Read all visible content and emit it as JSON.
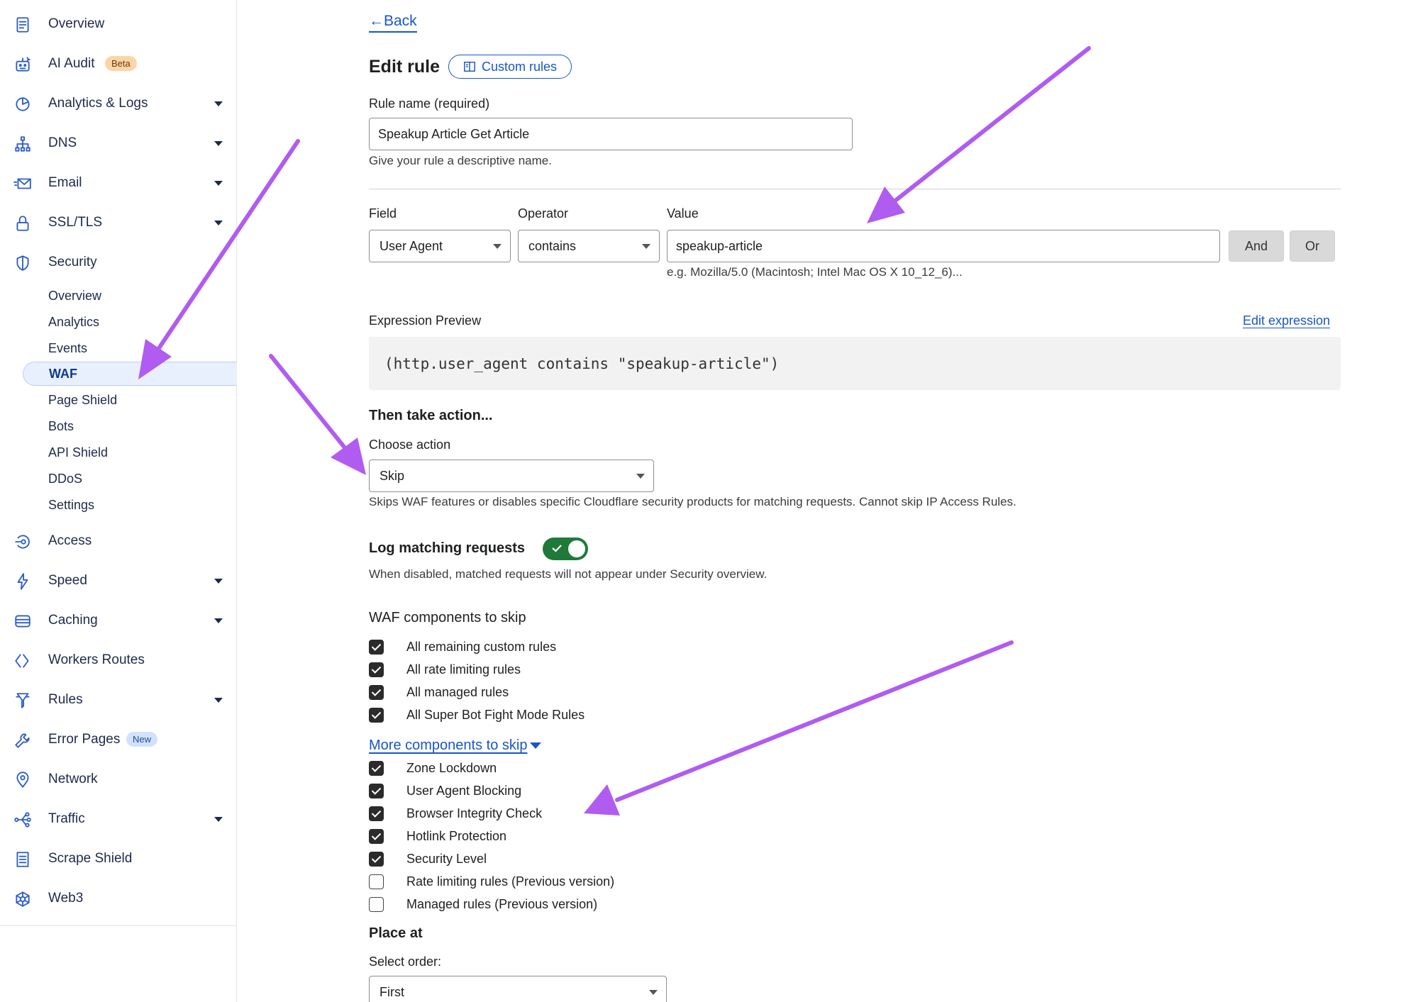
{
  "sidebar": {
    "items": [
      {
        "label": "Overview",
        "icon": "clipboard-icon",
        "caret": false
      },
      {
        "label": "AI Audit",
        "icon": "robot-icon",
        "caret": false,
        "badge": "Beta"
      },
      {
        "label": "Analytics & Logs",
        "icon": "pie-chart-icon",
        "caret": true
      },
      {
        "label": "DNS",
        "icon": "network-tree-icon",
        "caret": true
      },
      {
        "label": "Email",
        "icon": "envelope-icon",
        "caret": true
      },
      {
        "label": "SSL/TLS",
        "icon": "lock-icon",
        "caret": true
      },
      {
        "label": "Security",
        "icon": "shield-icon",
        "caret": false
      }
    ],
    "security_sub": [
      "Overview",
      "Analytics",
      "Events",
      "WAF",
      "Page Shield",
      "Bots",
      "API Shield",
      "DDoS",
      "Settings"
    ],
    "active_sub": "WAF",
    "items_after": [
      {
        "label": "Access",
        "icon": "access-icon",
        "caret": false
      },
      {
        "label": "Speed",
        "icon": "lightning-icon",
        "caret": true
      },
      {
        "label": "Caching",
        "icon": "server-stack-icon",
        "caret": true
      },
      {
        "label": "Workers Routes",
        "icon": "workers-icon",
        "caret": false
      },
      {
        "label": "Rules",
        "icon": "funnel-icon",
        "caret": true
      },
      {
        "label": "Error Pages",
        "icon": "wrench-icon",
        "caret": false,
        "badge": "New"
      },
      {
        "label": "Network",
        "icon": "location-pin-icon",
        "caret": false
      },
      {
        "label": "Traffic",
        "icon": "traffic-icon",
        "caret": true
      },
      {
        "label": "Scrape Shield",
        "icon": "document-icon",
        "caret": false
      },
      {
        "label": "Web3",
        "icon": "web3-icon",
        "caret": false
      }
    ]
  },
  "header": {
    "back_label": "Back",
    "title": "Edit rule",
    "custom_rules_label": "Custom rules"
  },
  "rule_name": {
    "label": "Rule name (required)",
    "value": "Speakup Article Get Article",
    "help": "Give your rule a descriptive name."
  },
  "expression": {
    "field_label": "Field",
    "field_value": "User Agent",
    "operator_label": "Operator",
    "operator_value": "contains",
    "value_label": "Value",
    "value_value": "speakup-article",
    "value_hint": "e.g. Mozilla/5.0 (Macintosh; Intel Mac OS X 10_12_6)...",
    "and_label": "And",
    "or_label": "Or",
    "preview_label": "Expression Preview",
    "edit_expression_label": "Edit expression",
    "preview_code": "(http.user_agent contains \"speakup-article\")"
  },
  "action": {
    "heading": "Then take action...",
    "choose_label": "Choose action",
    "selected": "Skip",
    "help": "Skips WAF features or disables specific Cloudflare security products for matching requests. Cannot skip IP Access Rules."
  },
  "logging": {
    "label": "Log matching requests",
    "enabled": true,
    "help": "When disabled, matched requests will not appear under Security overview."
  },
  "skip": {
    "heading": "WAF components to skip",
    "components": [
      {
        "label": "All remaining custom rules",
        "checked": true
      },
      {
        "label": "All rate limiting rules",
        "checked": true
      },
      {
        "label": "All managed rules",
        "checked": true
      },
      {
        "label": "All Super Bot Fight Mode Rules",
        "checked": true
      }
    ],
    "more_label": "More components to skip",
    "more_components": [
      {
        "label": "Zone Lockdown",
        "checked": true
      },
      {
        "label": "User Agent Blocking",
        "checked": true
      },
      {
        "label": "Browser Integrity Check",
        "checked": true
      },
      {
        "label": "Hotlink Protection",
        "checked": true
      },
      {
        "label": "Security Level",
        "checked": true
      },
      {
        "label": "Rate limiting rules (Previous version)",
        "checked": false
      },
      {
        "label": "Managed rules (Previous version)",
        "checked": false
      }
    ]
  },
  "placement": {
    "heading": "Place at",
    "order_label": "Select order:",
    "order_value": "First"
  },
  "colors": {
    "accent": "#1a56c9",
    "annotation_arrow": "#b05cf0",
    "toggle_on": "#1f7a3a"
  }
}
